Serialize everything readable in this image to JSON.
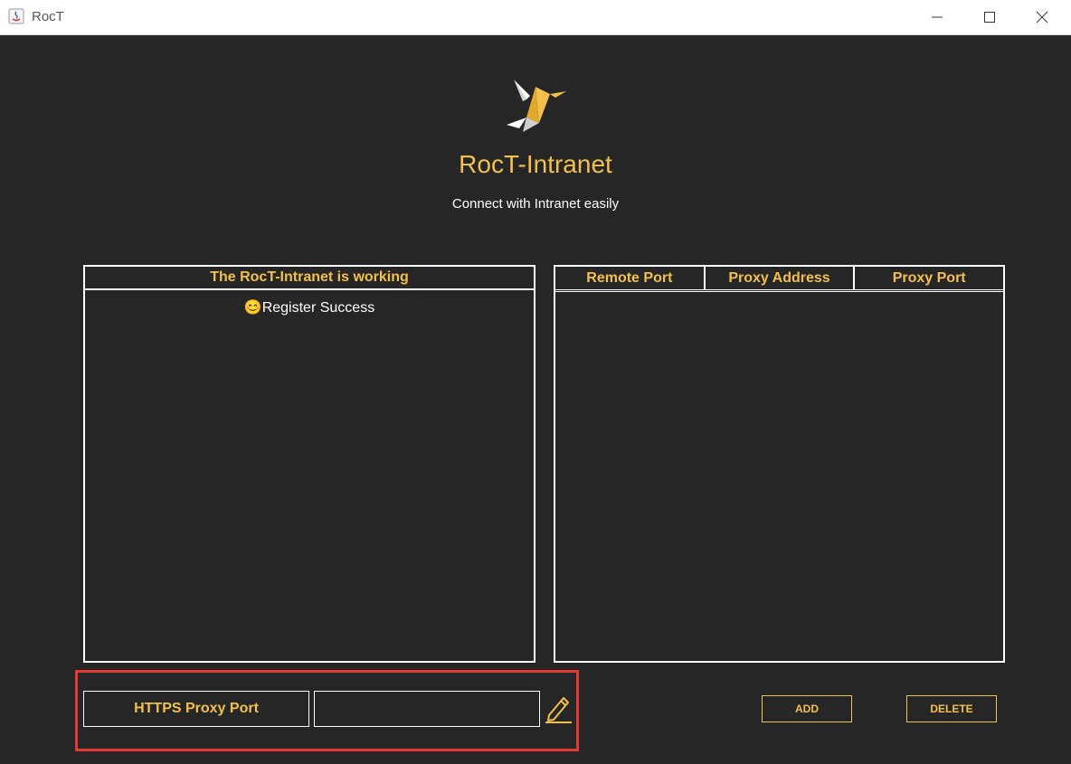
{
  "window": {
    "title": "RocT"
  },
  "header": {
    "app_name": "RocT-Intranet",
    "tagline": "Connect with Intranet easily"
  },
  "status_panel": {
    "title": "The RocT-Intranet is working",
    "log": [
      "😊Register Success"
    ]
  },
  "mapping_table": {
    "columns": [
      "Remote Port",
      "Proxy Address",
      "Proxy Port"
    ],
    "rows": []
  },
  "proxy_form": {
    "label": "HTTPS Proxy Port",
    "value": ""
  },
  "actions": {
    "add_label": "ADD",
    "delete_label": "DELETE"
  },
  "colors": {
    "accent": "#f3c04f",
    "background": "#262626",
    "highlight": "#e53935"
  }
}
